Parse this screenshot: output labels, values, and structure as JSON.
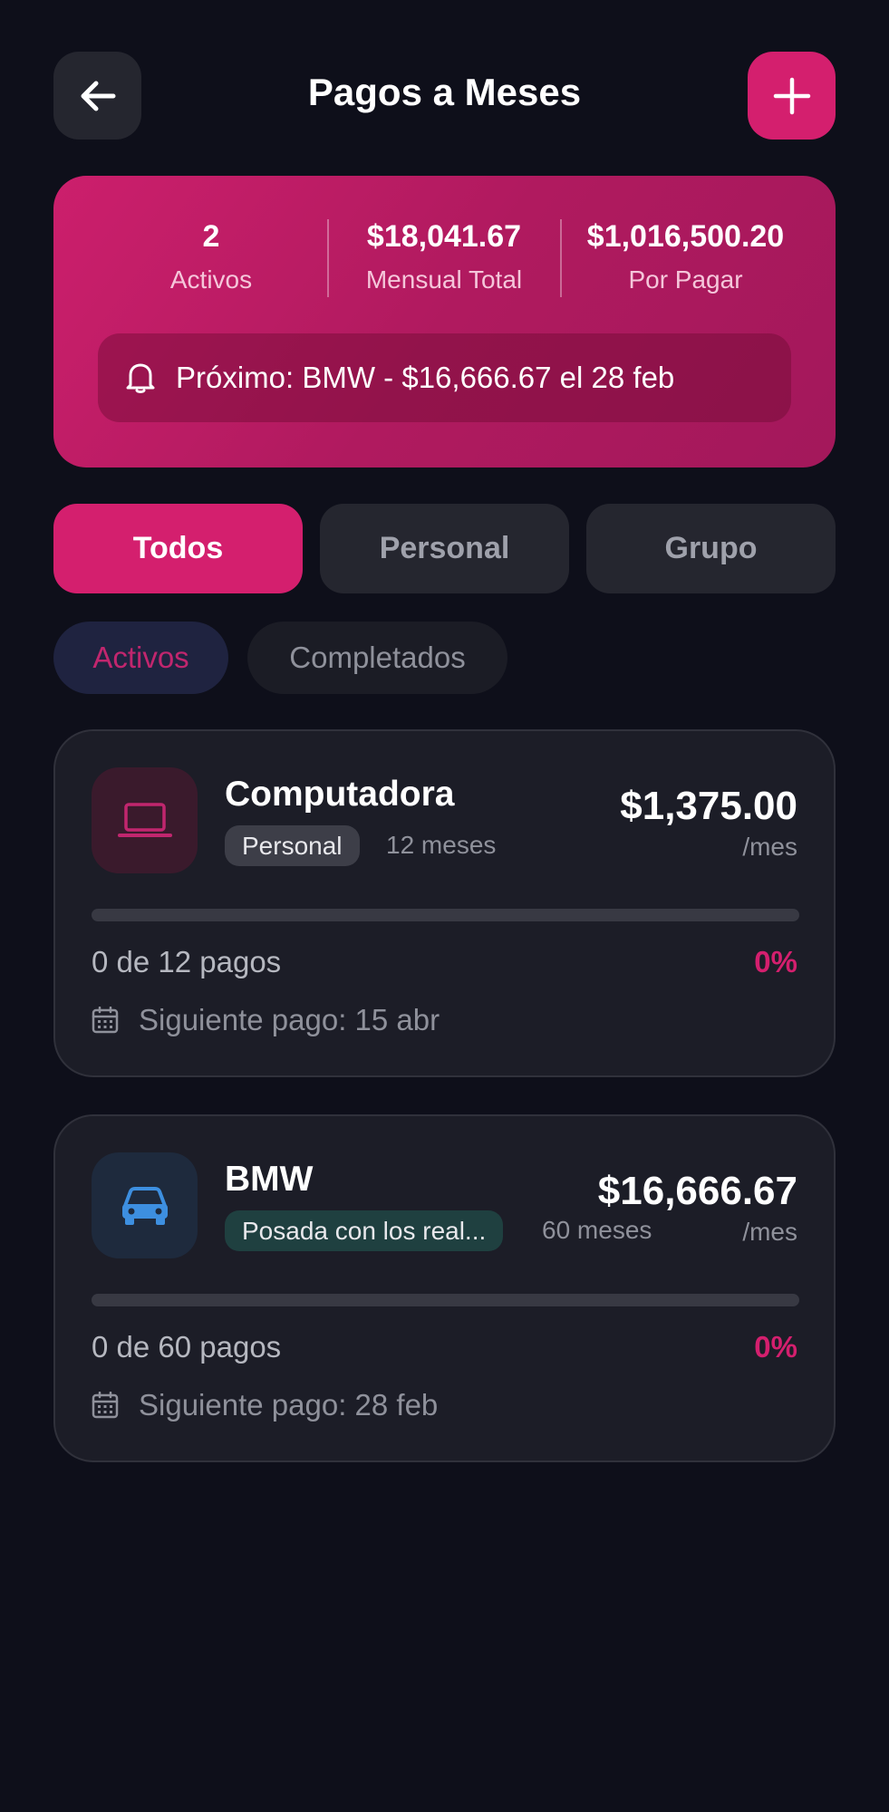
{
  "header": {
    "title": "Pagos a Meses",
    "back_icon": "arrow-left-icon",
    "add_icon": "plus-icon"
  },
  "summary": {
    "active_count": "2",
    "active_label": "Activos",
    "monthly_total": "$18,041.67",
    "monthly_label": "Mensual Total",
    "remaining_total": "$1,016,500.20",
    "remaining_label": "Por Pagar",
    "next_payment": "Próximo: BMW - $16,666.67 el 28 feb",
    "next_icon": "bell-icon"
  },
  "tabs": [
    {
      "label": "Todos",
      "active": true
    },
    {
      "label": "Personal",
      "active": false
    },
    {
      "label": "Grupo",
      "active": false
    }
  ],
  "filters": [
    {
      "label": "Activos",
      "active": true
    },
    {
      "label": "Completados",
      "active": false
    }
  ],
  "plans": [
    {
      "title": "Computadora",
      "icon": "laptop-icon",
      "tag": "Personal",
      "months": "12 meses",
      "amount": "$1,375.00",
      "per": "/mes",
      "progress_text": "0 de 12 pagos",
      "progress_percent": "0%",
      "progress_fraction": 0,
      "next_payment": "Siguiente pago: 15 abr"
    },
    {
      "title": "BMW",
      "icon": "car-icon",
      "tag": "Posada con los real...",
      "months": "60 meses",
      "amount": "$16,666.67",
      "per": "/mes",
      "progress_text": "0 de 60 pagos",
      "progress_percent": "0%",
      "progress_fraction": 0,
      "next_payment": "Siguiente pago: 28 feb"
    }
  ],
  "colors": {
    "background": "#0e0f1a",
    "accent": "#d41f6e",
    "card": "#1c1d27",
    "laptop_icon_bg": "#3a1a2c",
    "laptop_icon": "#c1266e",
    "car_icon_bg": "#1e2a3d",
    "car_icon": "#3d8fe0",
    "personal_tag_bg": "#3d3e48",
    "group_tag_bg": "#1f4040"
  }
}
